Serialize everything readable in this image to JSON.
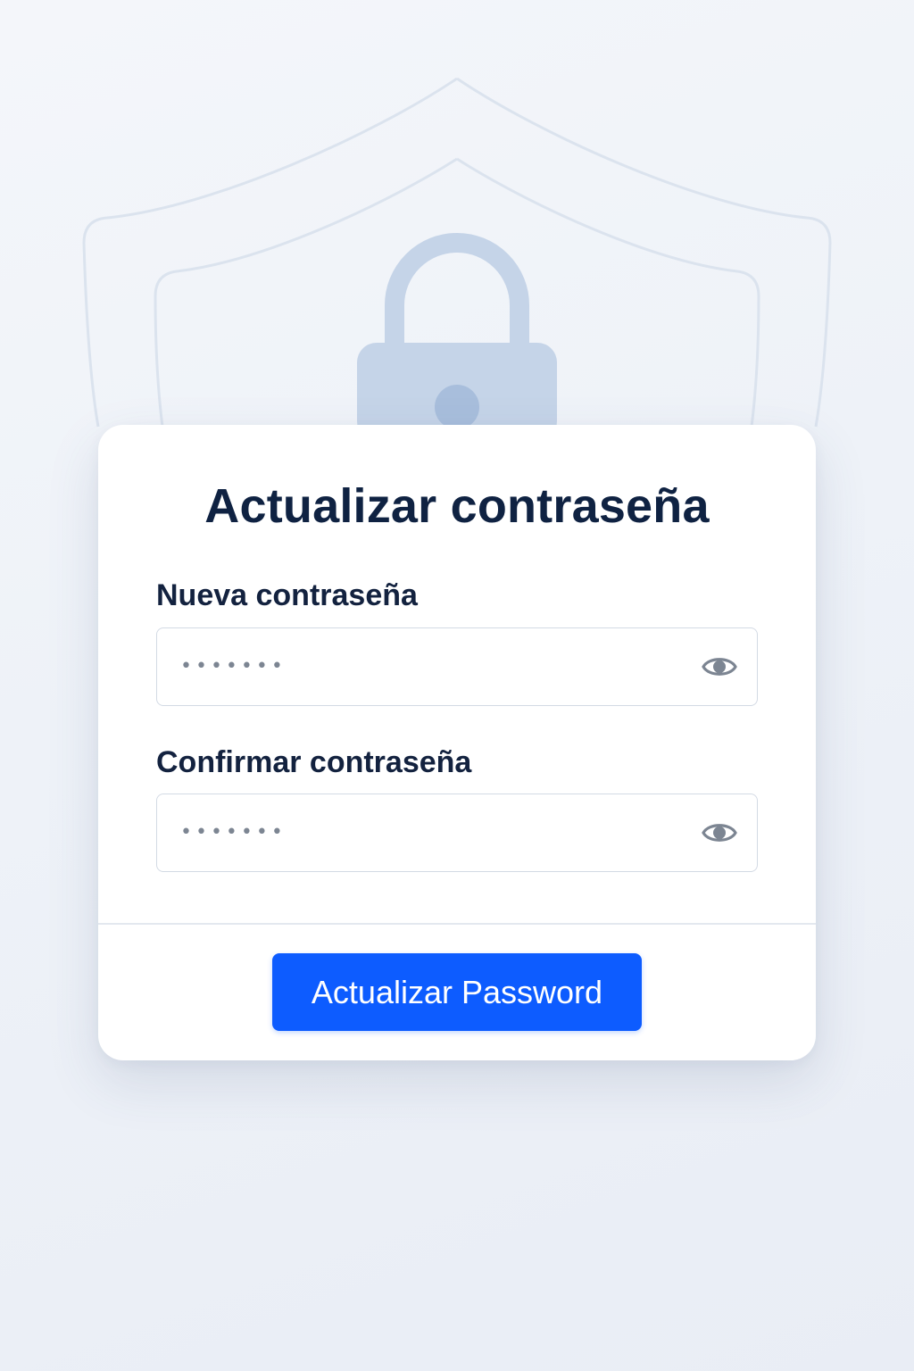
{
  "page": {
    "title": "Actualizar contraseña"
  },
  "form": {
    "new_password": {
      "label": "Nueva contraseña",
      "value": "•••••••",
      "toggle_icon": "eye-icon"
    },
    "confirm_password": {
      "label": "Confirmar contraseña",
      "value": "•••••••",
      "toggle_icon": "eye-icon"
    },
    "submit_label": "Actualizar Password"
  },
  "background": {
    "icons": [
      "shield-icon",
      "padlock-icon"
    ]
  },
  "colors": {
    "accent": "#0d5cff",
    "title": "#0f2242",
    "label": "#13223f",
    "field_border": "#d3dae4",
    "icon_muted": "#7c8592",
    "padlock": "#c5d4e8",
    "padlock_keyhole": "#a8bedc",
    "shield_stroke": "#dbe3ee"
  }
}
